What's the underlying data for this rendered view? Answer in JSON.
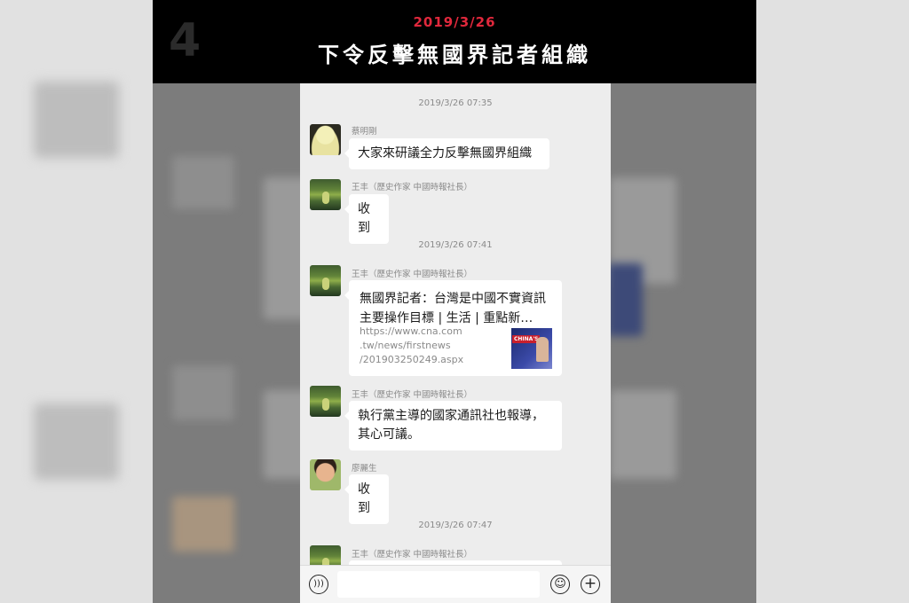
{
  "header": {
    "episode_number": "4",
    "date": "2019/3/26",
    "title": "下令反擊無國界記者組織"
  },
  "chat": {
    "timestamps": [
      "2019/3/26 07:35",
      "2019/3/26 07:41",
      "2019/3/26 07:47"
    ],
    "messages": [
      {
        "sender": "蔡明剛",
        "text": "大家來研議全力反擊無國界組織",
        "avatar": "buddha-avatar"
      },
      {
        "sender": "王丰（歷史作家 中國時報社長）",
        "text": "收到",
        "avatar": "forest-avatar"
      },
      {
        "sender": "王丰（歷史作家 中國時報社長）",
        "avatar": "forest-avatar",
        "link": {
          "title": "無國界記者：台灣是中國不實資訊主要操作目標 | 生活 | 重點新…",
          "url": "https://www.cna.com\n.tw/news/firstnews\n/201903250249.aspx",
          "thumb_badge": "CHINA'S"
        }
      },
      {
        "sender": "王丰（歷史作家 中國時報社長）",
        "text": "執行黨主導的國家通訊社也報導，其心可議。",
        "avatar": "forest-avatar"
      },
      {
        "sender": "廖麗生",
        "text": "收到",
        "avatar": "person-avatar"
      },
      {
        "sender": "王丰（歷史作家 中國時報社長）",
        "avatar": "forest-avatar"
      }
    ]
  },
  "input_bar": {
    "voice_icon": "voice-icon",
    "emoji_icon": "emoji-icon",
    "plus_icon": "plus-icon"
  },
  "colors": {
    "header_bg": "#000000",
    "date_red": "#e0283c",
    "chat_bg": "#ededed"
  }
}
